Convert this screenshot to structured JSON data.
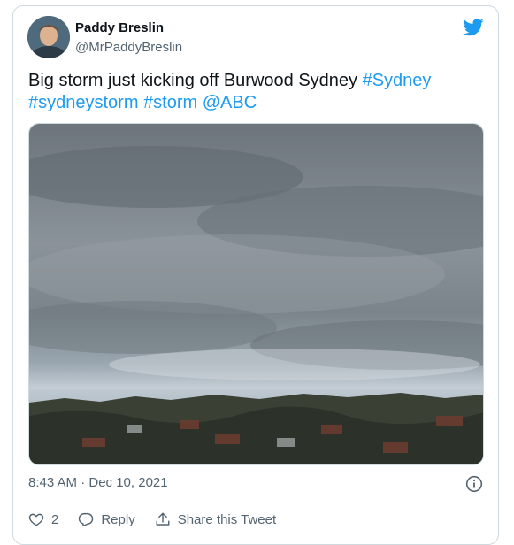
{
  "author": {
    "name": "Paddy Breslin",
    "handle": "@MrPaddyBreslin"
  },
  "tweet": {
    "text_plain": "Big storm just kicking off Burwood Sydney ",
    "hashtag_1": "#Sydney",
    "hashtag_2": "#sydneystorm",
    "hashtag_3": "#storm",
    "mention": "@ABC"
  },
  "timestamp": "8:43 AM · Dec 10, 2021",
  "actions": {
    "like_count": "2",
    "reply_label": "Reply",
    "share_label": "Share this Tweet"
  },
  "colors": {
    "link": "#1d9bf0",
    "text": "#0f1419",
    "secondary": "#536471",
    "border": "#cfd9de"
  },
  "icons": [
    "twitter-bird-icon",
    "info-icon",
    "heart-icon",
    "reply-icon",
    "share-icon"
  ]
}
